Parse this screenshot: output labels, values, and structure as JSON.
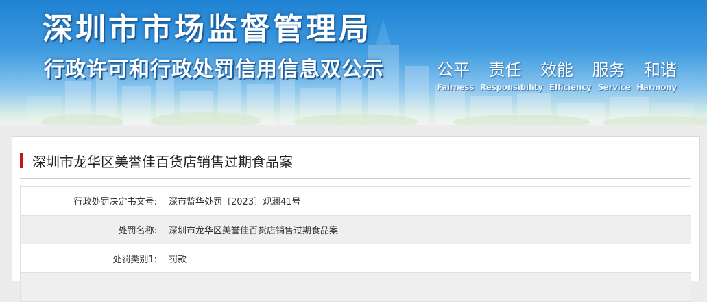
{
  "banner": {
    "title": "深圳市市场监督管理局",
    "subtitle": "行政许可和行政处罚信用信息双公示",
    "motto": [
      {
        "cn": "公平",
        "en": "Fairness"
      },
      {
        "cn": "责任",
        "en": "Responsibility"
      },
      {
        "cn": "效能",
        "en": "Efficiency"
      },
      {
        "cn": "服务",
        "en": "Service"
      },
      {
        "cn": "和谐",
        "en": "Harmony"
      }
    ]
  },
  "case": {
    "title": "深圳市龙华区美誉佳百货店销售过期食品案",
    "accent_color": "#c2161b",
    "rows": [
      {
        "label": "行政处罚决定书文号:",
        "value": "深市监华处罚〔2023〕观澜41号"
      },
      {
        "label": "处罚名称:",
        "value": "深圳市龙华区美誉佳百货店销售过期食品案"
      },
      {
        "label": "处罚类别1:",
        "value": "罚款"
      },
      {
        "label": "",
        "value": ""
      }
    ]
  }
}
